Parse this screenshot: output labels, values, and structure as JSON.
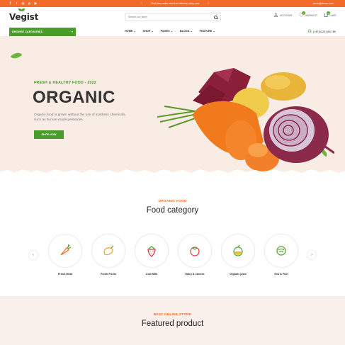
{
  "topbar": {
    "social_icons": [
      "facebook-icon",
      "twitter-icon",
      "instagram-icon",
      "pinterest-icon",
      "youtube-icon"
    ],
    "social_glyphs": [
      "f",
      "t",
      "◎",
      "p",
      "▶"
    ],
    "promo_text": "First time order and free delivery shop now",
    "email": "demo@demo.com",
    "bg_color": "#f26b2b"
  },
  "header": {
    "logo": "Vegist",
    "search_placeholder": "Search our store",
    "account_label": "ACCOUNT",
    "wishlist_label": "WISHLIST",
    "wishlist_count": "0",
    "cart_label": "CART",
    "cart_count": "0"
  },
  "nav": {
    "browse_label": "BROWSE CATEGORIES",
    "menu": [
      "HOME",
      "SHOP",
      "PAGES",
      "BLOGS",
      "FEATURE"
    ],
    "phone": "(+47)0123 456 789"
  },
  "hero": {
    "tagline": "FRESH & HEALTHY FOOD - 2022",
    "title": "ORGANIC",
    "description": "Organic food is grown without the use of synthetic chemicals, such as human-made pesticides.",
    "button": "SHOP NOW",
    "bg_color": "#f9ece5"
  },
  "categories": {
    "subtitle": "ORGANIC FOOD",
    "title": "Food category",
    "items": [
      {
        "label": "Fresh Meat",
        "icon": "carrot-icon"
      },
      {
        "label": "Fresh Fruits",
        "icon": "mango-icon"
      },
      {
        "label": "Cow Milk",
        "icon": "strawberry-icon"
      },
      {
        "label": "Dairy & cheese",
        "icon": "tomato-icon"
      },
      {
        "label": "Organic juice",
        "icon": "lemon-icon"
      },
      {
        "label": "Sea & Fish",
        "icon": "cabbage-icon"
      }
    ]
  },
  "featured": {
    "subtitle": "BEST ONLINE STORE",
    "title": "Featured product",
    "bg_color": "#f9f0eb"
  },
  "colors": {
    "accent_green": "#4a9d2a",
    "accent_orange": "#f26b2b"
  }
}
